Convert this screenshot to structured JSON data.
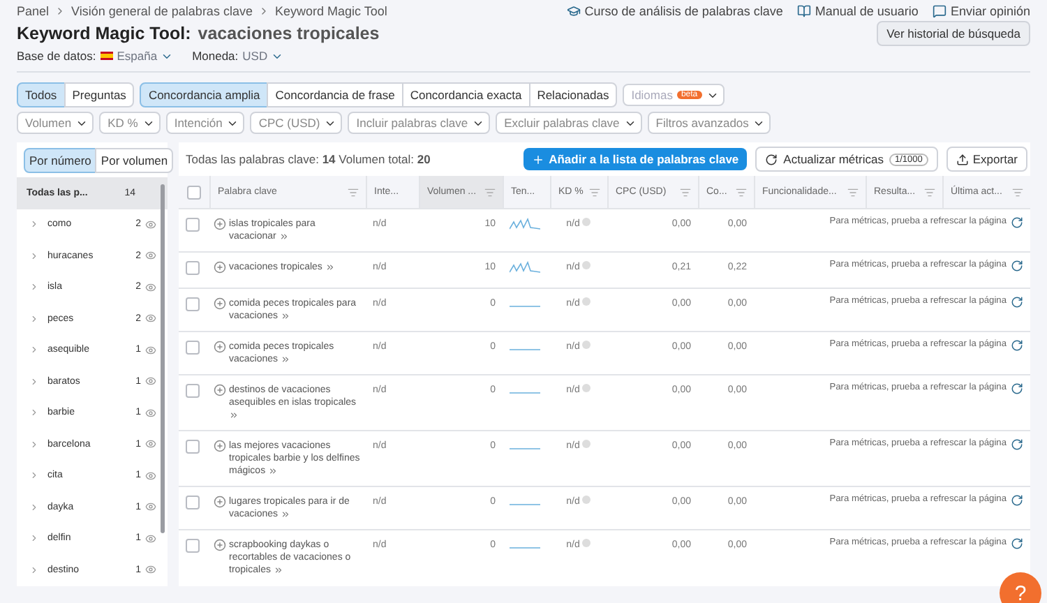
{
  "breadcrumbs": [
    "Panel",
    "Visión general de palabras clave",
    "Keyword Magic Tool"
  ],
  "top_links": [
    {
      "kind": "course",
      "label": "Curso de análisis de palabras clave"
    },
    {
      "kind": "manual",
      "label": "Manual de usuario"
    },
    {
      "kind": "feedback",
      "label": "Enviar opinión"
    }
  ],
  "title": "Keyword Magic Tool:",
  "query": "vacaciones tropicales",
  "history_button": "Ver historial de búsqueda",
  "database": {
    "label": "Base de datos:",
    "value": "España"
  },
  "currency": {
    "label": "Moneda:",
    "value": "USD"
  },
  "question_tabs": [
    {
      "label": "Todos",
      "selected": true
    },
    {
      "label": "Preguntas",
      "selected": false
    }
  ],
  "match_tabs": [
    {
      "label": "Concordancia amplia",
      "selected": true
    },
    {
      "label": "Concordancia de frase",
      "selected": false
    },
    {
      "label": "Concordancia exacta",
      "selected": false
    },
    {
      "label": "Relacionadas",
      "selected": false
    }
  ],
  "languages": {
    "label": "Idiomas",
    "badge": "beta",
    "disabled": true
  },
  "filters": [
    "Volumen",
    "KD %",
    "Intención",
    "CPC (USD)",
    "Incluir palabras clave",
    "Excluir palabras clave",
    "Filtros avanzados"
  ],
  "group_tabs": [
    {
      "label": "Por número",
      "selected": true
    },
    {
      "label": "Por volumen",
      "selected": false
    }
  ],
  "groups": [
    {
      "label": "Todas las p...",
      "count": "14",
      "selected": true,
      "all": true
    },
    {
      "label": "como",
      "count": "2",
      "selected": false
    },
    {
      "label": "huracanes",
      "count": "2",
      "selected": false
    },
    {
      "label": "isla",
      "count": "2",
      "selected": false
    },
    {
      "label": "peces",
      "count": "2",
      "selected": false
    },
    {
      "label": "asequible",
      "count": "1",
      "selected": false
    },
    {
      "label": "baratos",
      "count": "1",
      "selected": false
    },
    {
      "label": "barbie",
      "count": "1",
      "selected": false
    },
    {
      "label": "barcelona",
      "count": "1",
      "selected": false
    },
    {
      "label": "cita",
      "count": "1",
      "selected": false
    },
    {
      "label": "dayka",
      "count": "1",
      "selected": false
    },
    {
      "label": "delfin",
      "count": "1",
      "selected": false
    },
    {
      "label": "destino",
      "count": "1",
      "selected": false
    }
  ],
  "summary": {
    "keywords_label": "Todas las palabras clave:",
    "keywords": "14",
    "volume_label": "Volumen total:",
    "volume": "20"
  },
  "add_button": "Añadir a la lista de palabras clave",
  "refresh_button": {
    "label": "Actualizar métricas",
    "quota": "1/1000"
  },
  "export_button": "Exportar",
  "select_all_checked": false,
  "columns": [
    "Palabra clave",
    "Inte...",
    "Volumen ...",
    "Ten...",
    "KD %",
    "CPC (USD)",
    "Co...",
    "Funcionalidade...",
    "Resulta...",
    "Última act..."
  ],
  "rows": [
    {
      "keyword": "islas tropicales para vacacionar",
      "checked": false,
      "intent": "n/d",
      "volume": "10",
      "kind": "wave",
      "kd": "n/d",
      "cpc": "0,00",
      "com": "0,00",
      "note": "Para métricas, prueba a refrescar la página"
    },
    {
      "keyword": "vacaciones tropicales",
      "checked": false,
      "intent": "n/d",
      "volume": "10",
      "kind": "wave",
      "kd": "n/d",
      "cpc": "0,21",
      "com": "0,22",
      "note": "Para métricas, prueba a refrescar la página"
    },
    {
      "keyword": "comida peces tropicales para vacaciones",
      "checked": false,
      "intent": "n/d",
      "volume": "0",
      "kind": "flat",
      "kd": "n/d",
      "cpc": "0,00",
      "com": "0,00",
      "note": "Para métricas, prueba a refrescar la página"
    },
    {
      "keyword": "comida peces tropicales vacaciones",
      "checked": false,
      "intent": "n/d",
      "volume": "0",
      "kind": "flat",
      "kd": "n/d",
      "cpc": "0,00",
      "com": "0,00",
      "note": "Para métricas, prueba a refrescar la página"
    },
    {
      "keyword": "destinos de vacaciones asequibles en islas tropicales",
      "checked": false,
      "intent": "n/d",
      "volume": "0",
      "kind": "flat",
      "kd": "n/d",
      "cpc": "0,00",
      "com": "0,00",
      "note": "Para métricas, prueba a refrescar la página"
    },
    {
      "keyword": "las mejores vacaciones tropicales barbie y los delfines mágicos",
      "checked": false,
      "intent": "n/d",
      "volume": "0",
      "kind": "flat",
      "kd": "n/d",
      "cpc": "0,00",
      "com": "0,00",
      "note": "Para métricas, prueba a refrescar la página"
    },
    {
      "keyword": "lugares tropicales para ir de vacaciones",
      "checked": false,
      "intent": "n/d",
      "volume": "0",
      "kind": "flat",
      "kd": "n/d",
      "cpc": "0,00",
      "com": "0,00",
      "note": "Para métricas, prueba a refrescar la página"
    },
    {
      "keyword": "scrapbooking daykas o recortables de vacaciones o tropicales",
      "checked": false,
      "intent": "n/d",
      "volume": "0",
      "kind": "flat",
      "kd": "n/d",
      "cpc": "0,00",
      "com": "0,00",
      "note": "Para métricas, prueba a refrescar la página"
    }
  ],
  "help_button": "?"
}
